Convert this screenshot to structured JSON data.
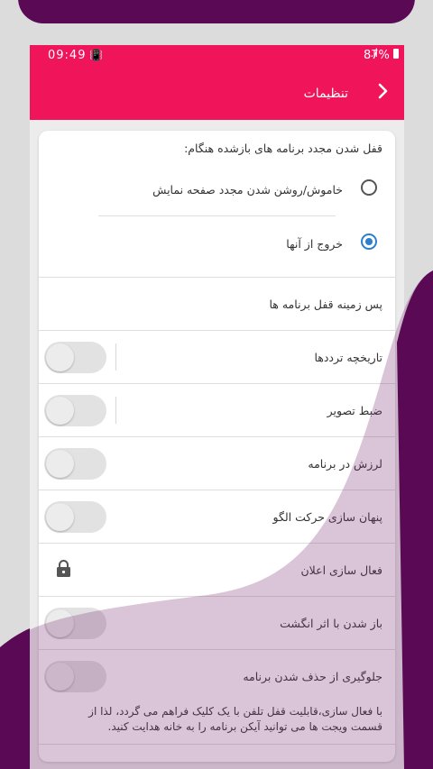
{
  "status_bar": {
    "time": "09:49",
    "signal_text": ".ıl",
    "battery": "87%"
  },
  "app_bar": {
    "title": "تنظیمات",
    "back_label": "‹"
  },
  "relock_section": {
    "header": "قفل شدن مجدد برنامه های بازشده هنگام:",
    "options": [
      {
        "label": "خاموش/روشن شدن مجدد صفحه نمایش",
        "selected": false
      },
      {
        "label": "خروج از آنها",
        "selected": true
      }
    ]
  },
  "background_item": {
    "label": "پس زمینه قفل برنامه ها"
  },
  "settings": [
    {
      "label": "تاریخچه ترددها",
      "on": false
    },
    {
      "label": "ضبط تصویر",
      "on": false
    },
    {
      "label": "لرزش در برنامه",
      "on": false
    },
    {
      "label": "پنهان سازی حرکت الگو",
      "on": false
    },
    {
      "label": "فعال سازی اعلان",
      "locked": true
    },
    {
      "label": "باز شدن با اثر انگشت",
      "on": false
    },
    {
      "label": "جلوگیری از حذف شدن برنامه",
      "on": false
    }
  ],
  "footer_note": "با فعال سازی،قابلیت قفل تلفن با یک کلیک فراهم می گردد، لذا از قسمت ویجت ها می توانید آیکن برنامه را به خانه هدایت کنید.",
  "colors": {
    "accent": "#f0155a",
    "radio_selected": "#2a7fd0",
    "purple": "#5a0a55"
  },
  "icons": {
    "lock": "lock-icon",
    "back": "chevron-right-icon"
  }
}
